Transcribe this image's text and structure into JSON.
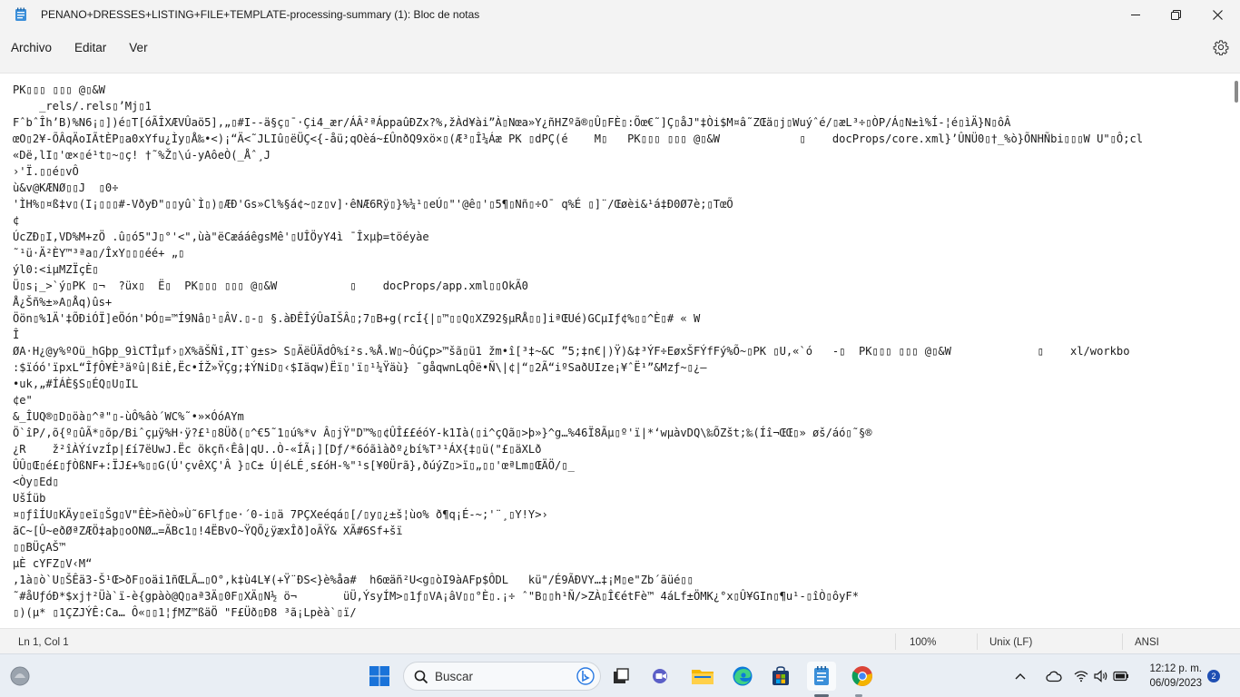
{
  "window": {
    "title": "PENANO+DRESSES+LISTING+FILE+TEMPLATE-processing-summary (1): Bloc de notas",
    "minimize": "—",
    "maximize": "❐",
    "close": "✕"
  },
  "menu": {
    "items": [
      "Archivo",
      "Editar",
      "Ver"
    ],
    "settings_icon": "gear-icon"
  },
  "editor": {
    "lines": [
      "PK▯▯▯ ▯▯▯ @▯&W",
      "    _rels/.rels▯’Mj▯1",
      "FˆbˆÎh’B)%N6¡▯])é▯T[óÃÎXÆVÛaö5],„▯#I--ä§ç▯ˉ·Çi4_ær/ÁÂ²ªÁppaûÐZx?%,žÀd¥ài”À▯Nœa»Y¿ñHZºã®▯Û▯FÈ▯:Õœ€˜]Ç▯åJ\"‡Òi$M¤â˜ZŒä▯j▯Wuýˆé/▯æL³÷▯ÒP/Á▯N±ì%Í-¦é▯ìÄ}N▯ôÂ",
      "œO▯2¥-ÕÂqÄoIÃtÈP▯a0xYfu¿Ìy▯Å‰•<)¡“Ä<˜JLIû▯ëÜÇ<{-åü;qOèá~£ÛnðQ9xö×▯(Æ³▯Î¼Áæ PK ▯dPÇ(é    M▯   PK▯▯▯ ▯▯▯ @▯&W            ▯    docProps/core.xml}’ÛNÜ0▯†_%ò}ÕNHÑbi▯▯▯W U\"▯Ô;cl",
      "«Dë,lI▯'œ×▯é¹t▯~▯ç! †˜%Ž▯\\ú-yAôeÒ(_Åˆ¸J",
      "›'Ï.▯▯é▯vÔ",
      "ù&v@KÆNØ▯▯J  ▯0÷",
      "'ÌH%▯¤ß‡v▯(I¡▯▯▯#-VðyÐ\"▯▯yû`Ì▯)▯ÆÐ'Gs»Cl%§á¢~▯z▯v]·êNÆ6Rÿ▯}%¼¹▯eÚ▯\"'@ê▯'▯5¶▯Nñ▯÷Oˉ q%É ▯]¨/Œøèi&¹á‡Ð0Ø7è;▯TœÕ",
      "¢",
      "ÚcZÐ▯I,VD%M+zÖ .û▯ó5\"J▯°'<\",ùà\"ëCæááêgsMê'▯UÎÖyY4ì ˉÎxµþ=töéyàe",
      "˜¹ü·Ä²ÈY™³ªa▯/ÎxY▯▯▯éé+ „▯",
      "ýl0:<iµMZÏçÈ▯",
      "Ü▯s¡_>`ý▯PK ▯¬  ?üx▯  Ë▯  PK▯▯▯ ▯▯▯ @▯&W           ▯    docProps/app.xml▯▯OkÃ0",
      "Å¿Šñ%±»A▯Åq)ûs+",
      "Öön▯%1Ä'‡ÕÐiÓÏ]eÖón'ÞÓ▯=™Í9Nâ▯¹▯ÂV.▯-▯ §.àÐÊÎýÛaIŠÂ▯;7▯B+g(rcÍ{|▯™▯▯Q▯XZ92§µRÅ▯▯]iªŒUé)GCµIƒ¢%▯▯^È▯# « W",
      "Î",
      "ØA·H¿@y%ºOü_hGþp_9ìCTÎµf›▯X%ãŠÑî,IT`g±s> S▯ÄëÜÄdÔ%í²s.%Å.W▯~ÔúÇp>™šã▯ü1 žm•î[³‡~&C ”5;‡n€|)Ÿ)&‡³ÝF÷EøxŠFÝfFý%Õ~▯PK ▯U,«`ó   -▯  PK▯▯▯ ▯▯▯ @▯&W             ▯    xl/workbo",
      ":$ïóó'ïpxL“ÎƒÔ¥È³äºû|ßiÈ,Ëc•ÍŽ»ŸÇg;‡ÝNiD▯‹$Iäqw)Ëï▯'ï▯¹¼Ÿäù} ˉgåqwnLqÔë•Ñ\\|¢|“▯2Ã“iºSaðUIze¡¥ˆË¹”&Mzƒ~▯¿–",
      "•uk,„#ÍÁÈ§S▯ÉQ▯U▯IL",
      "¢e\"",
      "&_ÎUQ®▯D▯öà▯^ª\"▯-ùÔ%âò´WC%˜•»×ÓóAYm",
      "Ö`îP/,õ{º▯ûÃ*▯õp/Biˆçµÿ%H·ÿ?£¹▯8Üð(▯^€5˜1▯ú%*v Â▯jŸ\"D™%▯¢ÛÎ££éóY-k1Ià(▯i^çQã▯>þ»}^g…%46Ï8Ãµ▯º'ï|*‘wµàvDQ\\‰ÕZšt;‰(Íî¬ŒŒ▯» øš/áó▯˜§®",
      "¿R    ž²îÀÝívzÍp|£í7ëUwJ.Ëc ökçñ‹Êâ|qU..Ò-«ÍÃ¡][Dƒ/*6óãìàðº¿bí%T³¹ÁX{‡▯ü(\"£▯äXLð",
      "ÛÛ▯Œ▯é£▯ƒÒßNF+:ÏJ£+%▯▯G(Ú'çvêXÇ'Â }▯C± Ú|éLÉ¸s£óH-%\"¹s[¥0Ürã},ðúýZ▯>ï▯„▯▯'œªLm▯ŒÄÖ/▯_",
      "<Òy▯Ed▯",
      "UšÍüb",
      "¤▯ƒîÍU▯KÄy▯eï▯Šg▯V\"ÊÈ>ñèÒ»Ù˜6Flƒ▯e·´0-i▯ä 7PÇXeéqá▯[/▯y▯¿±š¦ùo% ð¶q¡É-~;'¨¸▯Y!Y>›",
      "ãC~[Û~eðØªZÆÖ‡aþ▯oONØ…=ÃBc1▯!4ËBvO~ŸQÕ¿ÿæxÎð]oÃŸ& XÃ#6Sf+šï",
      "▯▯BÜçAŠ™",
      "µÈ cYFZ▯V‹M“",
      ",1à▯ò`U▯ŠÊä3-Š¹Œ>ðF▯oäi1ñŒLÃ…▯O°,k‡ù4L¥(+Ÿ¨ÐS<}è%åa#  h6œäñ²U<g▯òI9àAFp$ÔDL   kü\"/É9ÃÐVY…‡¡M▯e\"Zb´ãüé▯▯",
      "˜#åUƒóÐ*$xj†²Üà`ï-è{gpàò@Q▯aª3Ä▯0F▯XÄ▯N½ ö¬       üÜ,ÝsyÍM>▯1ƒ▯VA¡âV▯▯°È▯.¡÷ ˆ\"B▯▯h¹Ñ/>ZÀ▯Î€étFè™ 4áLf±ÖMK¿°x▯Û¥GIn▯¶u¹-▯îÒ▯ôyF*",
      "▯)(µ* ▯1ÇZJÝÊ:Ca… Ô«▯▯1¦ƒMZ™ßäÖ \"F£Üð▯Ð8 ³ã¡Lpèà`▯ï/"
    ]
  },
  "statusbar": {
    "position": "Ln 1, Col 1",
    "zoom": "100%",
    "line_ending": "Unix (LF)",
    "encoding": "ANSI"
  },
  "taskbar": {
    "search_placeholder": "Buscar",
    "clock_time": "12:12 p. m.",
    "clock_date": "06/09/2023",
    "notification_count": "2"
  }
}
